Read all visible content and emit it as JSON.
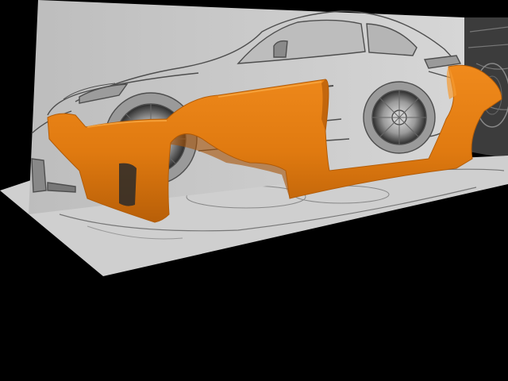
{
  "viewport": {
    "background": "#000000",
    "floor_plane_color": "#d2d2d2",
    "side_plane_color": "#d0d0d0",
    "blueprint_line_color": "#555555",
    "body_panel_color": "#e07a10",
    "body_panel_shade": "#a85406",
    "right_reference_color": "#4a4a4a"
  },
  "scene_objects": [
    "floor-reference-plane",
    "side-reference-plane",
    "car-blueprint",
    "widebody-panel-model",
    "right-reference-image"
  ]
}
